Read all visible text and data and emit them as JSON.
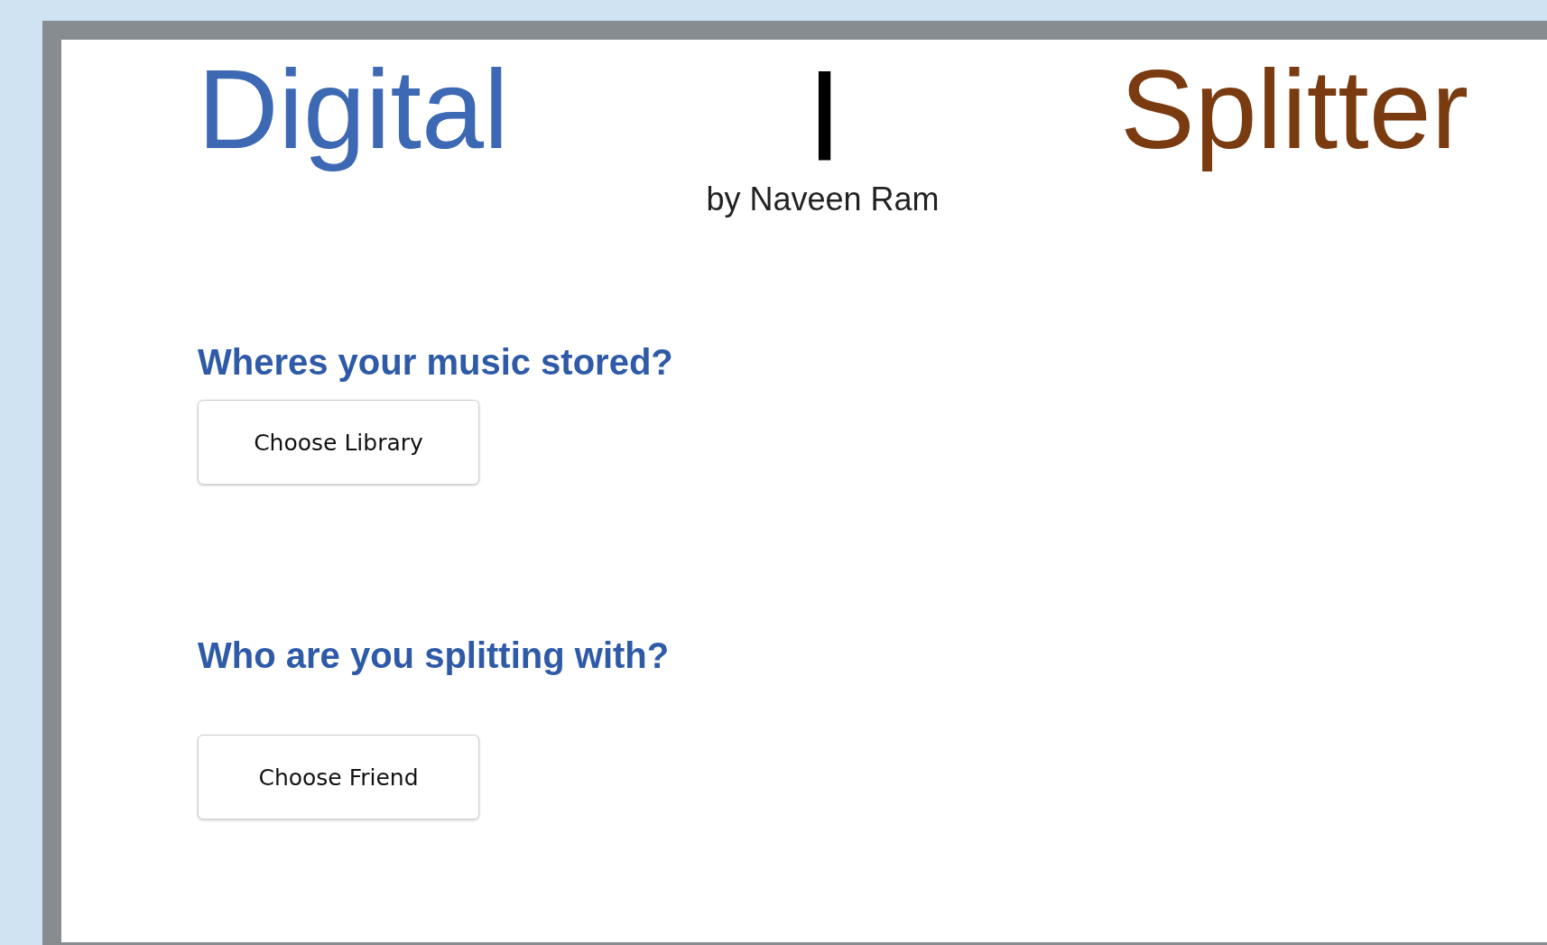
{
  "title": {
    "left": "Digital",
    "separator": "|",
    "right": "Splitter"
  },
  "subtitle": "by Naveen Ram",
  "sections": [
    {
      "question": "Wheres your music stored?",
      "button": "Choose Library"
    },
    {
      "question": "Who are you splitting with?",
      "button": "Choose Friend"
    }
  ]
}
